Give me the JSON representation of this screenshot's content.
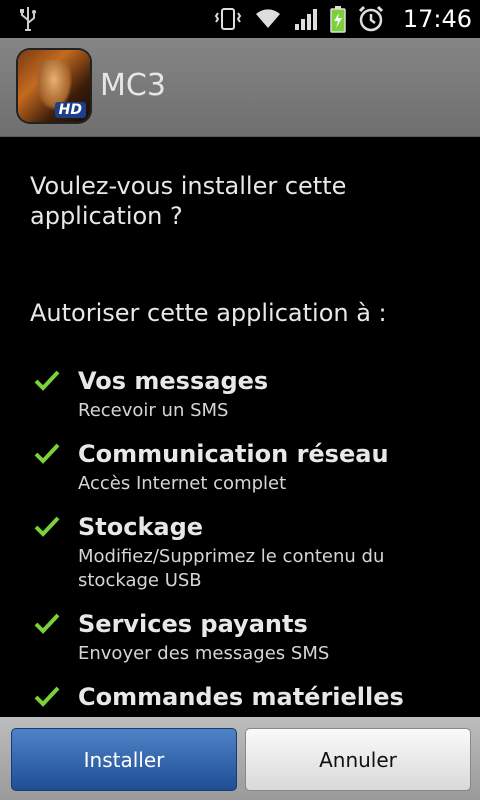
{
  "status_bar": {
    "time": "17:46"
  },
  "app": {
    "name": "MC3",
    "icon_badge": "HD"
  },
  "question": "Voulez-vous installer cette application ?",
  "authorize_heading": "Autoriser cette application à :",
  "permissions": [
    {
      "title": "Vos messages",
      "desc": "Recevoir un SMS"
    },
    {
      "title": "Communication réseau",
      "desc": "Accès Internet complet"
    },
    {
      "title": "Stockage",
      "desc": "Modifiez/Supprimez le contenu du stockage USB"
    },
    {
      "title": "Services payants",
      "desc": "Envoyer des messages SMS"
    },
    {
      "title": "Commandes matérielles",
      "desc": ""
    }
  ],
  "buttons": {
    "install": "Installer",
    "cancel": "Annuler"
  },
  "colors": {
    "check": "#7bd13a",
    "install_button": "#2a5fa8",
    "titlebar": "#7a7a7a"
  }
}
